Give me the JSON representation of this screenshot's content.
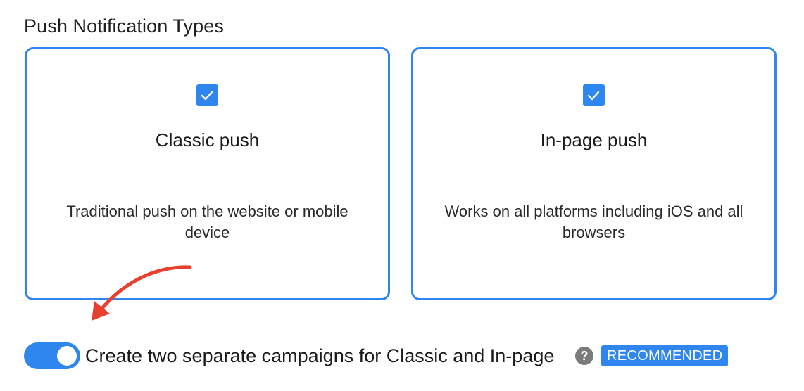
{
  "section": {
    "title": "Push Notification Types"
  },
  "cards": [
    {
      "title": "Classic push",
      "description": "Traditional push on the website or mobile device",
      "checked": true,
      "icon": "checkbox-checked-icon"
    },
    {
      "title": "In-page push",
      "description": "Works on all platforms including iOS and all browsers",
      "checked": true,
      "icon": "checkbox-checked-icon"
    }
  ],
  "separate_campaigns": {
    "label": "Create two separate campaigns for Classic and In-page",
    "enabled": true,
    "help_icon": "question-circle-icon",
    "help_glyph": "?",
    "badge": "RECOMMENDED"
  },
  "colors": {
    "accent": "#2f86ef",
    "annotation_arrow": "#e8402f",
    "help_icon": "#7b7b7b"
  }
}
